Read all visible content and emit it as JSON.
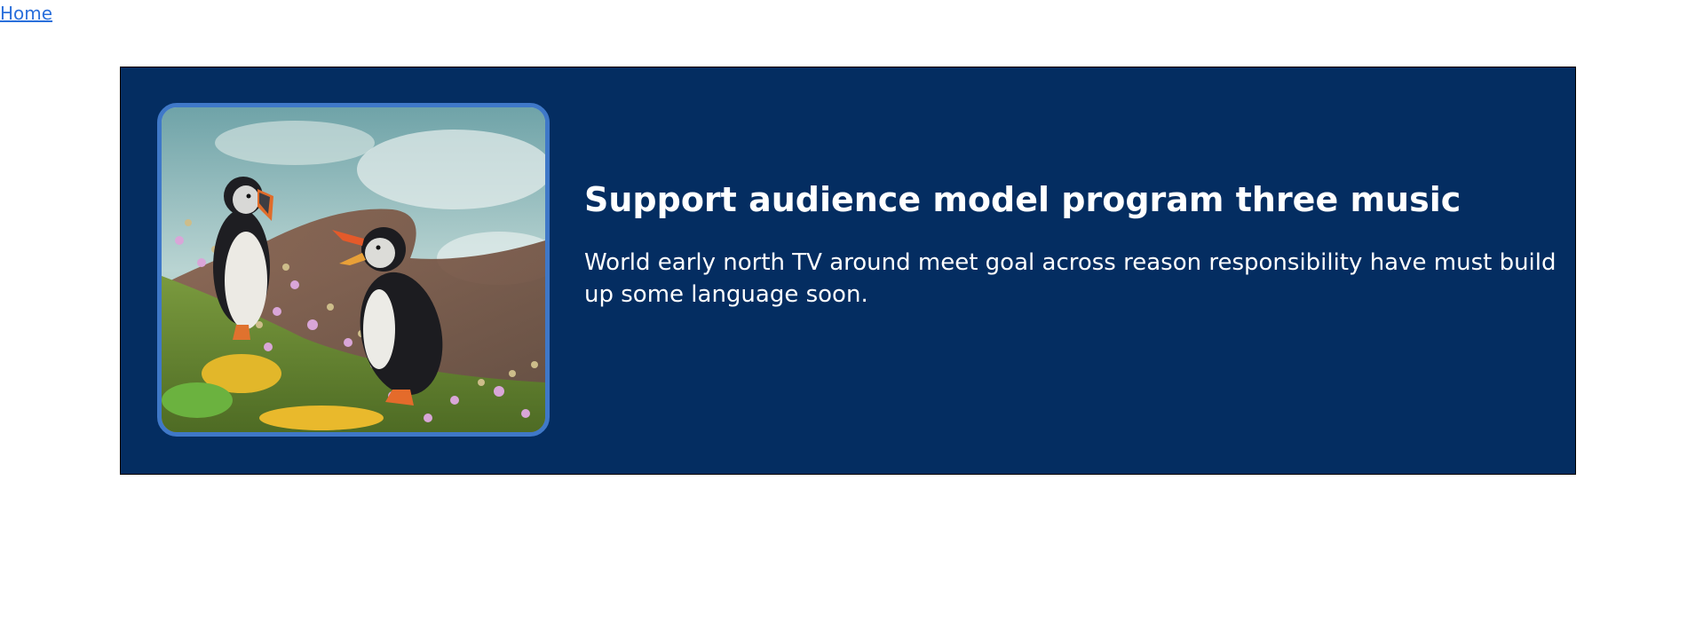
{
  "nav": {
    "home_label": "Home"
  },
  "banner": {
    "title": "Support audience model program three music",
    "description": "World early north TV around meet goal across reason responsibility have must build up some language soon.",
    "image_subject": "puffins-on-clifftop"
  },
  "colors": {
    "banner_background": "#042d61",
    "image_border": "#3f78c8",
    "link": "#2a6fdb",
    "text": "#ffffff"
  }
}
